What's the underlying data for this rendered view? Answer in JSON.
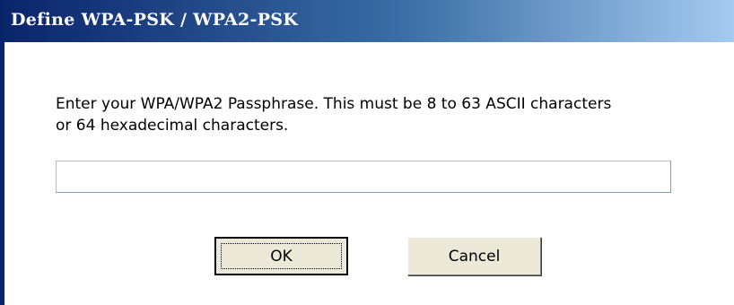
{
  "window": {
    "title": "Define WPA-PSK / WPA2-PSK"
  },
  "prompt": {
    "text": "Enter your WPA/WPA2 Passphrase. This must be 8 to 63 ASCII characters\nor 64 hexadecimal characters."
  },
  "passphrase_field": {
    "value": ""
  },
  "buttons": {
    "ok_label": "OK",
    "cancel_label": "Cancel"
  },
  "colors": {
    "titlebar_start": "#0a246a",
    "titlebar_end": "#a6caf0",
    "button_face": "#ece9d8"
  }
}
